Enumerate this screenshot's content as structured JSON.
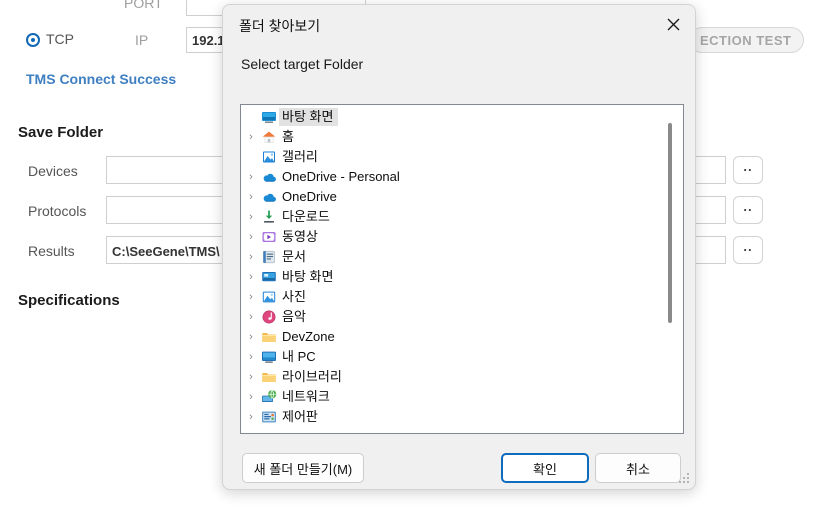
{
  "background_app": {
    "port_label": "PORT",
    "protocol_radio_label": "TCP",
    "ip_label": "IP",
    "ip_value": "192.1",
    "connection_test_label": "ECTION TEST",
    "status_text": "TMS Connect Success",
    "save_folder_heading": "Save Folder",
    "rows": [
      {
        "label": "Devices",
        "value": "",
        "browse_label": ".."
      },
      {
        "label": "Protocols",
        "value": "",
        "browse_label": ".."
      },
      {
        "label": "Results",
        "value": "C:\\SeeGene\\TMS\\",
        "browse_label": ".."
      }
    ],
    "specifications_heading": "Specifications",
    "accent_color": "#1267b5",
    "status_color": "#3f7fc1"
  },
  "dialog": {
    "title": "폴더 찾아보기",
    "close_icon": "close-icon",
    "prompt": "Select target Folder",
    "buttons": {
      "new_folder": "새 폴더 만들기(M)",
      "ok": "확인",
      "cancel": "취소"
    },
    "default_button_border_color": "#0f6cbd",
    "tree": {
      "selected_index": 0,
      "items": [
        {
          "label": "바탕 화면",
          "icon": "monitor-desktop-icon",
          "expandable": false,
          "selected": true
        },
        {
          "label": "홈",
          "icon": "home-icon",
          "expandable": true,
          "selected": false
        },
        {
          "label": "갤러리",
          "icon": "gallery-icon",
          "expandable": false,
          "selected": false
        },
        {
          "label": "OneDrive - Personal",
          "icon": "onedrive-cloud-icon",
          "expandable": true,
          "selected": false
        },
        {
          "label": "OneDrive",
          "icon": "onedrive-cloud-icon",
          "expandable": true,
          "selected": false
        },
        {
          "label": "다운로드",
          "icon": "download-icon",
          "expandable": true,
          "selected": false
        },
        {
          "label": "동영상",
          "icon": "videos-icon",
          "expandable": true,
          "selected": false
        },
        {
          "label": "문서",
          "icon": "documents-icon",
          "expandable": true,
          "selected": false
        },
        {
          "label": "바탕 화면",
          "icon": "desktop-folder-icon",
          "expandable": true,
          "selected": false
        },
        {
          "label": "사진",
          "icon": "pictures-icon",
          "expandable": true,
          "selected": false
        },
        {
          "label": "음악",
          "icon": "music-icon",
          "expandable": true,
          "selected": false
        },
        {
          "label": "DevZone",
          "icon": "folder-icon",
          "expandable": true,
          "selected": false
        },
        {
          "label": "내 PC",
          "icon": "this-pc-icon",
          "expandable": true,
          "selected": false
        },
        {
          "label": "라이브러리",
          "icon": "folder-icon",
          "expandable": true,
          "selected": false
        },
        {
          "label": "네트워크",
          "icon": "network-icon",
          "expandable": true,
          "selected": false
        },
        {
          "label": "제어판",
          "icon": "control-panel-icon",
          "expandable": true,
          "selected": false
        }
      ]
    }
  }
}
